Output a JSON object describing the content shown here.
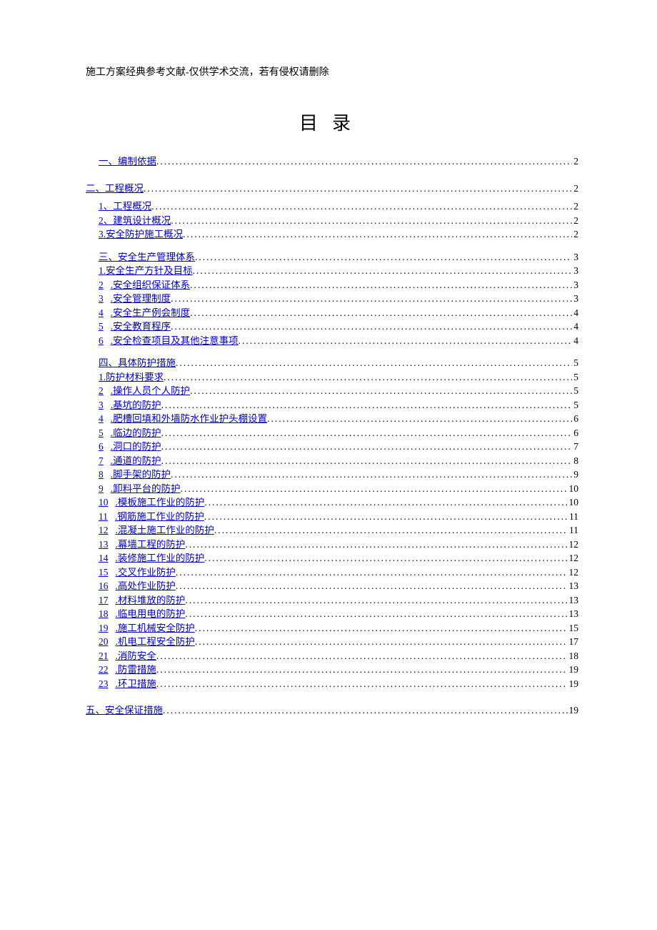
{
  "header_note": "施工方案经典参考文献-仅供学术交流，若有侵权请删除",
  "title": "目录",
  "toc": [
    {
      "level": 1,
      "num": "",
      "text": "一、编制依据",
      "page": "2",
      "gap": false
    },
    {
      "level": 0,
      "num": "",
      "text": "二、工程概况",
      "page": "2",
      "gap": false
    },
    {
      "level": 1,
      "num": "",
      "text": "1、工程概况",
      "page": "2",
      "gap": false
    },
    {
      "level": 2,
      "num": "",
      "text": "2、建筑设计概况",
      "page": "2",
      "gap": false
    },
    {
      "level": 2,
      "num": "",
      "text": "3.安全防护施工概况",
      "page": "2",
      "gap": false
    },
    {
      "level": 1,
      "num": "",
      "text": "三、安全生产管理体系",
      "page": "3",
      "gap": true
    },
    {
      "level": 2,
      "num": "",
      "text": "1.安全生产方针及目标",
      "page": "3",
      "gap": false
    },
    {
      "level": 2,
      "num": "2",
      "text": ".安全组织保证体系",
      "page": "3",
      "gap": false
    },
    {
      "level": 2,
      "num": "3",
      "text": ".安全管理制度",
      "page": "3",
      "gap": false
    },
    {
      "level": 2,
      "num": "4",
      "text": ".安全生产例会制度",
      "page": "4",
      "gap": false
    },
    {
      "level": 2,
      "num": "5",
      "text": ".安全教育程序",
      "page": "4",
      "gap": false
    },
    {
      "level": 2,
      "num": "6",
      "text": ".安全检查项目及其他注意事项",
      "page": "4",
      "gap": false
    },
    {
      "level": 1,
      "num": "",
      "text": "四、具体防护措施",
      "page": "5",
      "gap": true
    },
    {
      "level": 2,
      "num": "",
      "text": "1.防护材料要求",
      "page": "5",
      "gap": false
    },
    {
      "level": 2,
      "num": "2",
      "text": ".操作人员个人防护",
      "page": "5",
      "gap": false
    },
    {
      "level": 2,
      "num": "3",
      "text": ".基坑的防护",
      "page": "5",
      "gap": false
    },
    {
      "level": 2,
      "num": "4",
      "text": ".肥槽回填和外墙防水作业护头棚设置",
      "page": "6",
      "gap": false
    },
    {
      "level": 2,
      "num": "5",
      "text": ".临边的防护",
      "page": "6",
      "gap": false
    },
    {
      "level": 2,
      "num": "6",
      "text": ".洞口的防护",
      "page": "7",
      "gap": false
    },
    {
      "level": 2,
      "num": "7",
      "text": ".通道的防护",
      "page": "8",
      "gap": false
    },
    {
      "level": 2,
      "num": "8",
      "text": ".脚手架的防护",
      "page": "9",
      "gap": false
    },
    {
      "level": 2,
      "num": "9",
      "text": ".卸料平台的防护",
      "page": "10",
      "gap": false
    },
    {
      "level": 2,
      "num": "10",
      "text": ".模板施工作业的防护",
      "page": "10",
      "gap": false
    },
    {
      "level": 2,
      "num": "11",
      "text": ".钢筋施工作业的防护",
      "page": "11",
      "gap": false
    },
    {
      "level": 2,
      "num": "12",
      "text": ".混凝土施工作业的防护",
      "page": "11",
      "gap": false
    },
    {
      "level": 2,
      "num": "13",
      "text": ".幕墙工程的防护",
      "page": "12",
      "gap": false
    },
    {
      "level": 2,
      "num": "14",
      "text": ".装修施工作业的防护",
      "page": "12",
      "gap": false
    },
    {
      "level": 2,
      "num": "15",
      "text": ".交叉作业防护",
      "page": "12",
      "gap": false
    },
    {
      "level": 2,
      "num": "16",
      "text": ".高处作业防护",
      "page": "13",
      "gap": false
    },
    {
      "level": 2,
      "num": "17",
      "text": ".材料堆放的防护",
      "page": "13",
      "gap": false
    },
    {
      "level": 2,
      "num": "18",
      "text": ".临电用电的防护",
      "page": "13",
      "gap": false
    },
    {
      "level": 2,
      "num": "19",
      "text": ".施工机械安全防护",
      "page": "15",
      "gap": false
    },
    {
      "level": 2,
      "num": "20",
      "text": ".机电工程安全防护",
      "page": "17",
      "gap": false
    },
    {
      "level": 2,
      "num": "21",
      "text": ".消防安全",
      "page": "18",
      "gap": false
    },
    {
      "level": 2,
      "num": "22",
      "text": ".防雷措施",
      "page": "19",
      "gap": false
    },
    {
      "level": 2,
      "num": "23",
      "text": ".环卫措施",
      "page": "19",
      "gap": false
    },
    {
      "level": 0,
      "num": "",
      "text": "五、安全保证措施",
      "page": "19",
      "gap": false
    }
  ]
}
